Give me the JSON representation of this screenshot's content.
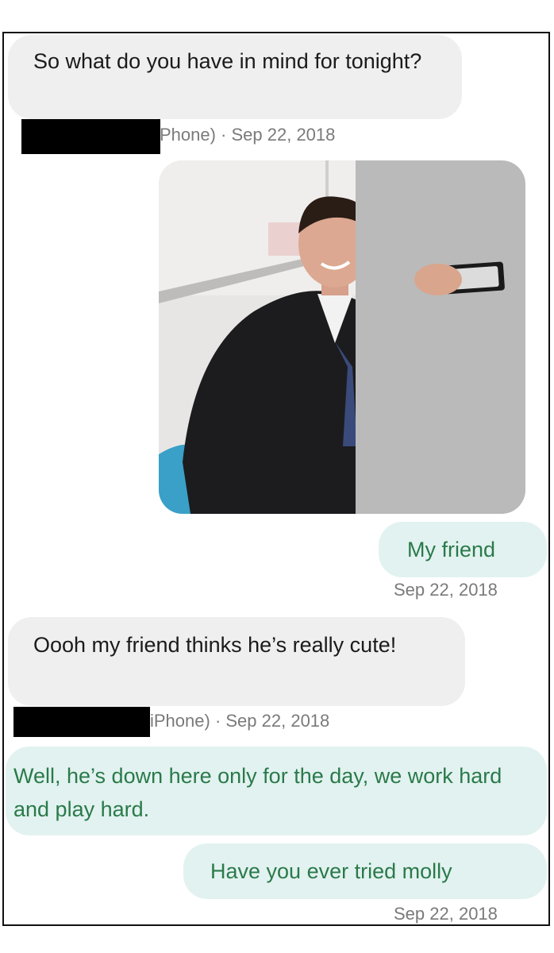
{
  "messages": [
    {
      "direction": "incoming",
      "text": "So what do you have in mind for tonight?",
      "meta": "Phone) · Sep 22, 2018"
    },
    {
      "direction": "outgoing",
      "type": "image",
      "image_alt": "Photo of a smiling man in a dark suit taking a selfie in a classroom; part of the image is covered by a grey redaction block"
    },
    {
      "direction": "outgoing",
      "text": "My friend",
      "meta": "Sep 22, 2018"
    },
    {
      "direction": "incoming",
      "text": "Oooh my friend thinks he’s really cute!",
      "meta": "iPhone) · Sep 22, 2018"
    },
    {
      "direction": "outgoing",
      "text": "Well, he’s down here only for the day, we work hard and play hard."
    },
    {
      "direction": "outgoing",
      "text": "Have you ever tried molly",
      "meta": "Sep 22, 2018"
    }
  ],
  "colors": {
    "incoming_bubble": "#efefef",
    "outgoing_bubble": "#e2f2f0",
    "outgoing_text": "#2a7a4a",
    "meta_text": "#7a7a7a"
  }
}
